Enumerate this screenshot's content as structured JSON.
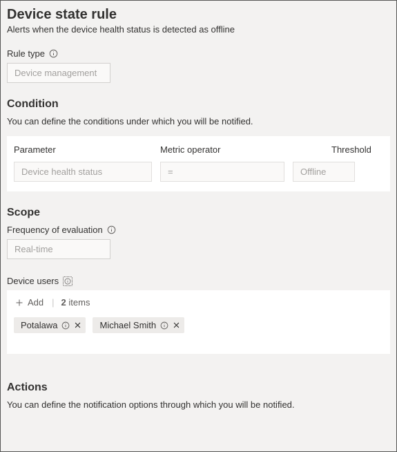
{
  "header": {
    "title": "Device state rule",
    "description": "Alerts when the device health status is detected as offline"
  },
  "ruleType": {
    "label": "Rule type",
    "value": "Device management"
  },
  "condition": {
    "heading": "Condition",
    "description": "You can define the conditions under which you will be notified.",
    "columns": {
      "parameter": "Parameter",
      "metricOperator": "Metric operator",
      "threshold": "Threshold"
    },
    "values": {
      "parameter": "Device health status",
      "metricOperator": "=",
      "threshold": "Offline"
    }
  },
  "scope": {
    "heading": "Scope",
    "frequencyLabel": "Frequency of evaluation",
    "frequencyValue": "Real-time",
    "usersLabel": "Device users",
    "addLabel": "Add",
    "itemsCount": "2",
    "itemsWord": "items",
    "users": [
      {
        "name": "Potalawa"
      },
      {
        "name": "Michael Smith"
      }
    ]
  },
  "actions": {
    "heading": "Actions",
    "description": "You can define the notification options through which you will be notified."
  }
}
